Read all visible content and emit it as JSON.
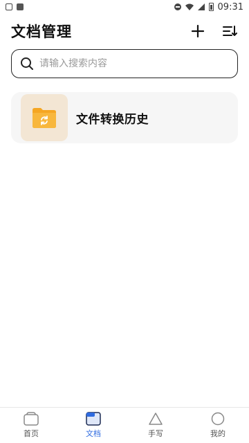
{
  "status_bar": {
    "time": "09:31",
    "left_icons": [
      "image-icon",
      "text-a-icon"
    ],
    "right_icons": [
      "dnd-icon",
      "wifi-icon",
      "signal-icon",
      "battery-icon"
    ]
  },
  "header": {
    "title": "文档管理",
    "actions": [
      "plus-icon",
      "sort-list-icon"
    ]
  },
  "search": {
    "placeholder": "请输入搜索内容",
    "value": ""
  },
  "cards": [
    {
      "label": "文件转换历史",
      "icon": "folder-sync-icon"
    }
  ],
  "bottom_nav": {
    "items": [
      {
        "label": "首页",
        "icon": "home-icon",
        "active": false
      },
      {
        "label": "文档",
        "icon": "document-icon",
        "active": true
      },
      {
        "label": "手写",
        "icon": "triangle-icon",
        "active": false
      },
      {
        "label": "我的",
        "icon": "profile-circle-icon",
        "active": false
      }
    ]
  },
  "colors": {
    "accent": "#2f6be0",
    "folder": "#f5a623",
    "card_bg": "#f6f6f6",
    "thumb_bg": "#f3e6d4"
  }
}
